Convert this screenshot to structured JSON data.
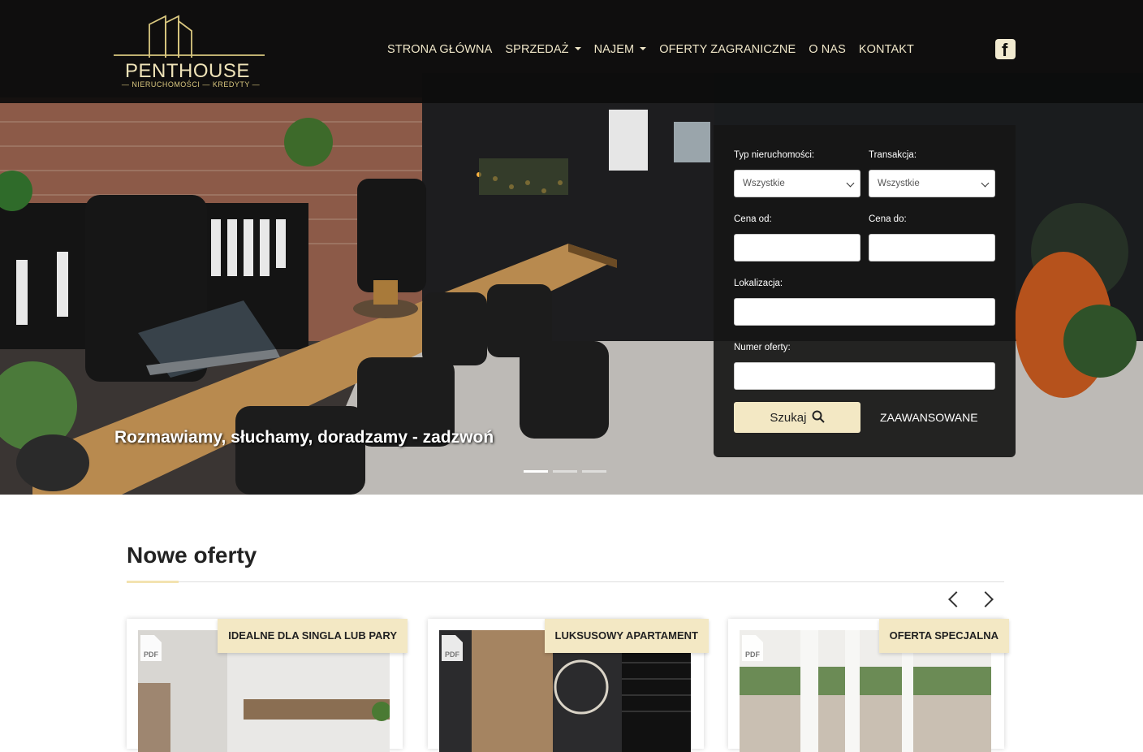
{
  "brand": {
    "name": "PENTHOUSE",
    "tagline": "— NIERUCHOMOŚCI — KREDYTY —"
  },
  "nav": {
    "items": [
      {
        "label": "STRONA GŁÓWNA",
        "dropdown": false
      },
      {
        "label": "SPRZEDAŻ",
        "dropdown": true
      },
      {
        "label": "NAJEM",
        "dropdown": true
      },
      {
        "label": "OFERTY ZAGRANICZNE",
        "dropdown": false
      },
      {
        "label": "O NAS",
        "dropdown": false
      },
      {
        "label": "KONTAKT",
        "dropdown": false
      }
    ],
    "social_icon": "facebook-icon"
  },
  "hero": {
    "caption": "Rozmawiamy, słuchamy, doradzamy - zadzwoń",
    "slides": 3,
    "active_slide": 1
  },
  "search": {
    "type_label": "Typ nieruchomości:",
    "type_value": "Wszystkie",
    "transaction_label": "Transakcja:",
    "transaction_value": "Wszystkie",
    "price_from_label": "Cena od:",
    "price_to_label": "Cena do:",
    "location_label": "Lokalizacja:",
    "offer_number_label": "Numer oferty:",
    "search_button": "Szukaj",
    "advanced_button": "ZAAWANSOWANE"
  },
  "section": {
    "title": "Nowe oferty",
    "cards": [
      {
        "badge": "IDEALNE DLA SINGLA LUB PARY",
        "pdf": "PDF"
      },
      {
        "badge": "LUKSUSOWY APARTAMENT",
        "pdf": "PDF"
      },
      {
        "badge": "OFERTA SPECJALNA",
        "pdf": "PDF"
      }
    ]
  },
  "colors": {
    "accent": "#f3e8c4",
    "header_bg": "#0c0c0c",
    "gold": "#d9c77f"
  }
}
